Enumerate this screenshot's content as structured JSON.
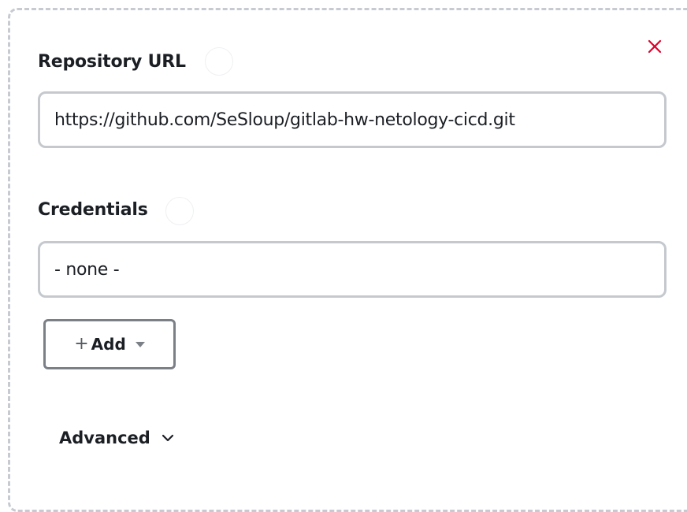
{
  "form": {
    "close_icon": "close-icon",
    "repository_url": {
      "label": "Repository URL",
      "value": "https://github.com/SeSloup/gitlab-hw-netology-cicd.git"
    },
    "credentials": {
      "label": "Credentials",
      "selected": "- none -",
      "add_label": "Add",
      "add_plus": "+"
    },
    "advanced_label": "Advanced"
  },
  "colors": {
    "close": "#e0002a",
    "border": "#c5c9ce",
    "button_border": "#7b8087",
    "text": "#1b1f24"
  }
}
